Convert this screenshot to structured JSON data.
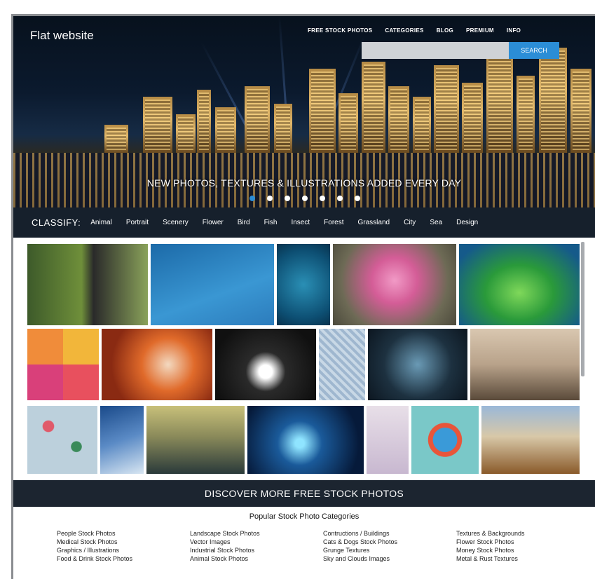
{
  "header": {
    "logo": "Flat website",
    "nav": [
      "FREE STOCK PHOTOS",
      "CATEGORIES",
      "BLOG",
      "PREMIUM",
      "INFO"
    ],
    "search_button": "SEARCH",
    "tagline": "NEW PHOTOS, TEXTURES & ILLUSTRATIONS ADDED EVERY DAY"
  },
  "slider": {
    "dot_count": 7,
    "active_index": 0
  },
  "classify": {
    "label": "CLASSIFY:",
    "categories": [
      "Animal",
      "Portrait",
      "Scenery",
      "Flower",
      "Bird",
      "Fish",
      "Insect",
      "Forest",
      "Grassland",
      "City",
      "Sea",
      "Design"
    ]
  },
  "discover": "DISCOVER MORE FREE STOCK PHOTOS",
  "popular": {
    "title": "Popular Stock Photo Categories",
    "columns": [
      [
        "People Stock Photos",
        "Medical Stock Photos",
        "Graphics / Illustrations",
        "Food & Drink Stock Photos"
      ],
      [
        "Landscape Stock Photos",
        "Vector Images",
        "Industrial Stock Photos",
        "Animal Stock Photos"
      ],
      [
        "Contructions / Buildings",
        "Cats & Dogs Stock Photos",
        "Grunge Textures",
        "Sky and Clouds Images"
      ],
      [
        "Textures & Backgrounds",
        "Flower Stock Photos",
        "Money Stock Photos",
        "Metal & Rust Textures"
      ]
    ]
  },
  "colors": {
    "accent": "#2b8dd6",
    "dark_bar": "#16202c",
    "discover_bar": "#1c2530"
  }
}
